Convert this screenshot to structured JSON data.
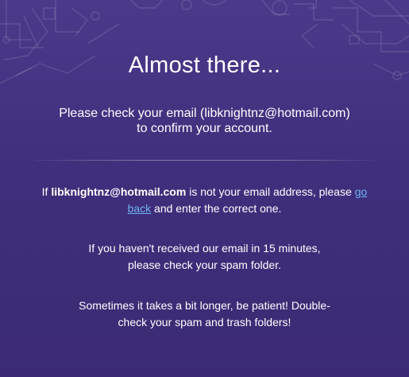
{
  "header": {
    "title": "Almost there...",
    "subtitle_line1": "Please check your email (libknightnz@hotmail.com)",
    "subtitle_line2": "to confirm your account."
  },
  "body": {
    "wrong_email": {
      "prefix": "If ",
      "email": "libknightnz@hotmail.com",
      "middle": " is not your email address, please ",
      "link": "go back",
      "suffix": " and enter the correct one."
    },
    "not_received_line1": "If you haven't received our email in 15 minutes,",
    "not_received_line2": "please check your spam folder.",
    "patience_line1": "Sometimes it takes a bit longer, be patient! Double-",
    "patience_line2": "check your spam and trash folders!"
  },
  "colors": {
    "background_top": "#4a3a8a",
    "background_bottom": "#3b2a73",
    "link": "#6fb3f2",
    "text": "#ffffff"
  }
}
